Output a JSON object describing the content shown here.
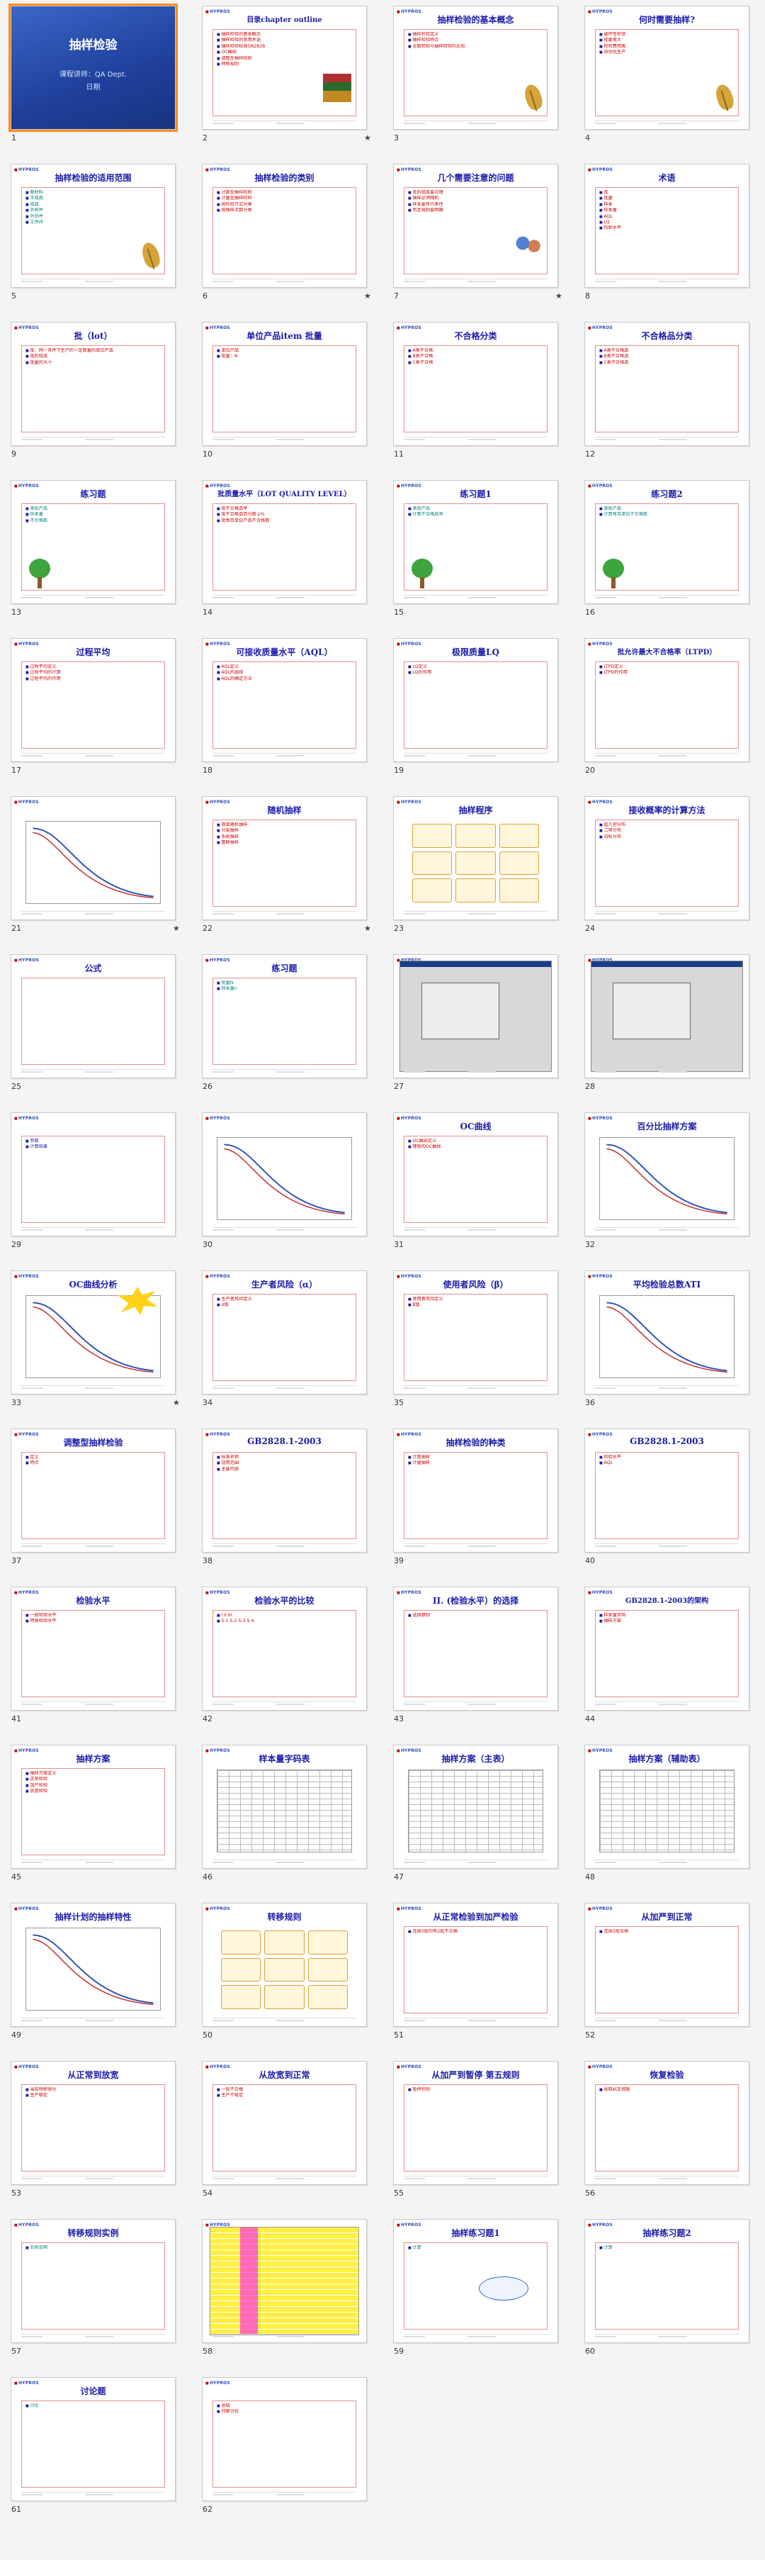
{
  "slides": [
    {
      "n": "1",
      "type": "cover",
      "title": "抽样检验",
      "sub": "课程讲师：QA Dept.",
      "sub2": "日期"
    },
    {
      "n": "2",
      "type": "text",
      "title": "目录chapter outline",
      "star": true,
      "lines": [
        "抽样检验的基本概念",
        "抽样检验的常用术语",
        "抽样检验标准GB2828",
        "OC曲线",
        "调整型抽样检验",
        "转移规则"
      ],
      "color": "red",
      "pic": "books"
    },
    {
      "n": "3",
      "type": "text",
      "title": "抽样检验的基本概念",
      "star": false,
      "lines": [
        "抽样检验定义",
        "抽样检验特点",
        "全数检验与抽样检验的比较"
      ],
      "color": "red",
      "pic": "leaf"
    },
    {
      "n": "4",
      "type": "text",
      "title": "何时需要抽样?",
      "lines": [
        "破坏性检验",
        "批量很大",
        "检验费用高",
        "自动化生产"
      ],
      "color": "red",
      "pic": "leaf"
    },
    {
      "n": "5",
      "type": "text",
      "title": "抽样检验的适用范围",
      "lines": [
        "原材料",
        "半成品",
        "成品",
        "外购件",
        "外协件",
        "工序间"
      ],
      "color": "teal",
      "pic": "leaf"
    },
    {
      "n": "6",
      "type": "text",
      "title": "抽样检验的类别",
      "star": true,
      "lines": [
        "计数型抽样检验",
        "计量型抽样检验",
        "按检验方式分类",
        "按抽样次数分类"
      ],
      "color": "red"
    },
    {
      "n": "7",
      "type": "text",
      "title": "几个需要注意的问题",
      "star": true,
      "lines": [
        "批的组成要合理",
        "抽样必须随机",
        "样本要有代表性",
        "判定规则要明确"
      ],
      "color": "red",
      "pic": "people"
    },
    {
      "n": "8",
      "type": "text",
      "title": "术语",
      "lines": [
        "批",
        "批量",
        "样本",
        "样本量",
        "AQL",
        "LQ",
        "检验水平"
      ],
      "color": "red"
    },
    {
      "n": "9",
      "type": "text",
      "title": "批（lot）",
      "lines": [
        "批：同一条件下生产的一定数量的单位产品",
        "批的组成",
        "批量的大小"
      ],
      "color": "red"
    },
    {
      "n": "10",
      "type": "text",
      "title": "单位产品item 批量",
      "lines": [
        "单位产品",
        "批量：N"
      ],
      "color": "red"
    },
    {
      "n": "11",
      "type": "text",
      "title": "不合格分类",
      "lines": [
        "A类不合格",
        "B类不合格",
        "C类不合格"
      ],
      "color": "red"
    },
    {
      "n": "12",
      "type": "text",
      "title": "不合格品分类",
      "lines": [
        "A类不合格品",
        "B类不合格品",
        "C类不合格品"
      ],
      "color": "red"
    },
    {
      "n": "13",
      "type": "text",
      "title": "练习题",
      "lines": [
        "某批产品",
        "样本量",
        "不合格数"
      ],
      "color": "teal",
      "pic": "tree"
    },
    {
      "n": "14",
      "type": "text",
      "title": "批质量水平（LOT QUALITY LEVEL）",
      "lines": [
        "批不合格品率",
        "批不合格品百分数 p%",
        "批每百单位产品不合格数"
      ],
      "color": "red"
    },
    {
      "n": "15",
      "type": "text",
      "title": "练习题1",
      "lines": [
        "某批产品",
        "计算不合格品率"
      ],
      "color": "teal",
      "pic": "tree"
    },
    {
      "n": "16",
      "type": "text",
      "title": "练习题2",
      "lines": [
        "某批产品",
        "计算每百单位不合格数"
      ],
      "color": "teal",
      "pic": "tree"
    },
    {
      "n": "17",
      "type": "text",
      "title": "过程平均",
      "lines": [
        "过程平均定义",
        "过程平均的计算",
        "过程平均的作用"
      ],
      "color": "red"
    },
    {
      "n": "18",
      "type": "text",
      "title": "可接收质量水平（AQL）",
      "lines": [
        "AQL定义",
        "AQL的选择",
        "AQL的确定方法"
      ],
      "color": "red"
    },
    {
      "n": "19",
      "type": "text",
      "title": "极限质量LQ",
      "lines": [
        "LQ定义",
        "LQ的作用"
      ],
      "color": "red"
    },
    {
      "n": "20",
      "type": "text",
      "title": "批允许最大不合格率（LTPD）",
      "lines": [
        "LTPD定义",
        "LTPD的作用"
      ],
      "color": "red"
    },
    {
      "n": "21",
      "type": "curve",
      "title": "",
      "star": true
    },
    {
      "n": "22",
      "type": "text",
      "title": "随机抽样",
      "star": true,
      "lines": [
        "简单随机抽样",
        "分层抽样",
        "系统抽样",
        "整群抽样"
      ],
      "color": "red"
    },
    {
      "n": "23",
      "type": "flow",
      "title": "抽样程序"
    },
    {
      "n": "24",
      "type": "text",
      "title": "接收概率的计算方法",
      "lines": [
        "超几何分布",
        "二项分布",
        "泊松分布"
      ],
      "color": "red"
    },
    {
      "n": "25",
      "type": "text",
      "title": "公式",
      "lines": [],
      "color": "red"
    },
    {
      "n": "26",
      "type": "text",
      "title": "练习题",
      "lines": [
        "批量N",
        "样本量n"
      ],
      "color": "teal"
    },
    {
      "n": "27",
      "type": "shot",
      "title": ""
    },
    {
      "n": "28",
      "type": "shot",
      "title": ""
    },
    {
      "n": "29",
      "type": "text",
      "title": "",
      "lines": [
        "参数",
        "计算结果"
      ],
      "color": "blue"
    },
    {
      "n": "30",
      "type": "curve",
      "title": ""
    },
    {
      "n": "31",
      "type": "text",
      "title": "OC曲线",
      "lines": [
        "OC曲线定义",
        "理想的OC曲线"
      ],
      "color": "red"
    },
    {
      "n": "32",
      "type": "curve",
      "title": "百分比抽样方案"
    },
    {
      "n": "33",
      "type": "curve",
      "title": "OC曲线分析",
      "star": true,
      "burst": true
    },
    {
      "n": "34",
      "type": "text",
      "title": "生产者风险（α）",
      "lines": [
        "生产者风险定义",
        "α值"
      ],
      "color": "red"
    },
    {
      "n": "35",
      "type": "text",
      "title": "使用者风险（β）",
      "lines": [
        "使用者风险定义",
        "β值"
      ],
      "color": "red"
    },
    {
      "n": "36",
      "type": "curve",
      "title": "平均检验总数ATI"
    },
    {
      "n": "37",
      "type": "text",
      "title": "调整型抽样检验",
      "lines": [
        "定义",
        "特点"
      ],
      "color": "red"
    },
    {
      "n": "38",
      "type": "text",
      "title": "GB2828.1-2003",
      "lines": [
        "标准名称",
        "适用范围",
        "主要内容"
      ],
      "color": "red"
    },
    {
      "n": "39",
      "type": "text",
      "title": "抽样检验的种类",
      "lines": [
        "计数抽样",
        "计量抽样"
      ],
      "color": "red"
    },
    {
      "n": "40",
      "type": "text",
      "title": "GB2828.1-2003",
      "lines": [
        "检验水平",
        "AQL"
      ],
      "color": "red"
    },
    {
      "n": "41",
      "type": "text",
      "title": "检验水平",
      "lines": [
        "一般检验水平",
        "特殊检验水平"
      ],
      "color": "red"
    },
    {
      "n": "42",
      "type": "text",
      "title": "检验水平的比较",
      "lines": [
        "I II III",
        "S-1 S-2 S-3 S-4"
      ],
      "color": "red"
    },
    {
      "n": "43",
      "type": "text",
      "title": "II. (检验水平）的选择",
      "lines": [
        "选择原则"
      ],
      "color": "red"
    },
    {
      "n": "44",
      "type": "text",
      "title": "GB2828.1-2003的架构",
      "lines": [
        "样本量字码",
        "抽样方案"
      ],
      "color": "red"
    },
    {
      "n": "45",
      "type": "text",
      "title": "抽样方案",
      "lines": [
        "抽样方案定义",
        "正常检验",
        "加严检验",
        "放宽检验"
      ],
      "color": "red"
    },
    {
      "n": "46",
      "type": "table",
      "title": "样本量字码表"
    },
    {
      "n": "47",
      "type": "table",
      "title": "抽样方案（主表）"
    },
    {
      "n": "48",
      "type": "table",
      "title": "抽样方案（辅助表）"
    },
    {
      "n": "49",
      "type": "curve",
      "title": "抽样计划的抽样特性"
    },
    {
      "n": "50",
      "type": "flow",
      "title": "转移规则"
    },
    {
      "n": "51",
      "type": "text",
      "title": "从正常检验到加严检验",
      "lines": [
        "连续5批中有2批不合格"
      ],
      "color": "red"
    },
    {
      "n": "52",
      "type": "text",
      "title": "从加严到正常",
      "lines": [
        "连续5批合格"
      ],
      "color": "red"
    },
    {
      "n": "53",
      "type": "text",
      "title": "从正常到放宽",
      "lines": [
        "当前转移得分",
        "生产稳定"
      ],
      "color": "red"
    },
    {
      "n": "54",
      "type": "text",
      "title": "从放宽到正常",
      "lines": [
        "一批不合格",
        "生产不稳定"
      ],
      "color": "red"
    },
    {
      "n": "55",
      "type": "text",
      "title": "从加严到暂停 第五规则",
      "lines": [
        "暂停检验"
      ],
      "color": "red"
    },
    {
      "n": "56",
      "type": "text",
      "title": "恢复检验",
      "lines": [
        "采取纠正措施"
      ],
      "color": "red"
    },
    {
      "n": "57",
      "type": "text",
      "title": "转移规则实例",
      "lines": [
        "实例说明"
      ],
      "color": "teal"
    },
    {
      "n": "58",
      "type": "colored",
      "title": ""
    },
    {
      "n": "59",
      "type": "text",
      "title": "抽样练习题1",
      "lines": [
        "计算"
      ],
      "color": "teal",
      "cloud": true
    },
    {
      "n": "60",
      "type": "text",
      "title": "抽样练习题2",
      "lines": [
        "计算"
      ],
      "color": "teal"
    },
    {
      "n": "61",
      "type": "text",
      "title": "讨论题",
      "lines": [
        "讨论"
      ],
      "color": "teal"
    },
    {
      "n": "62",
      "type": "text",
      "title": "",
      "lines": [
        "总结",
        "问题讨论"
      ],
      "color": "red"
    }
  ],
  "ui": {
    "logo": "HYPROS",
    "star_glyph": "★",
    "selected_slide": "1"
  }
}
